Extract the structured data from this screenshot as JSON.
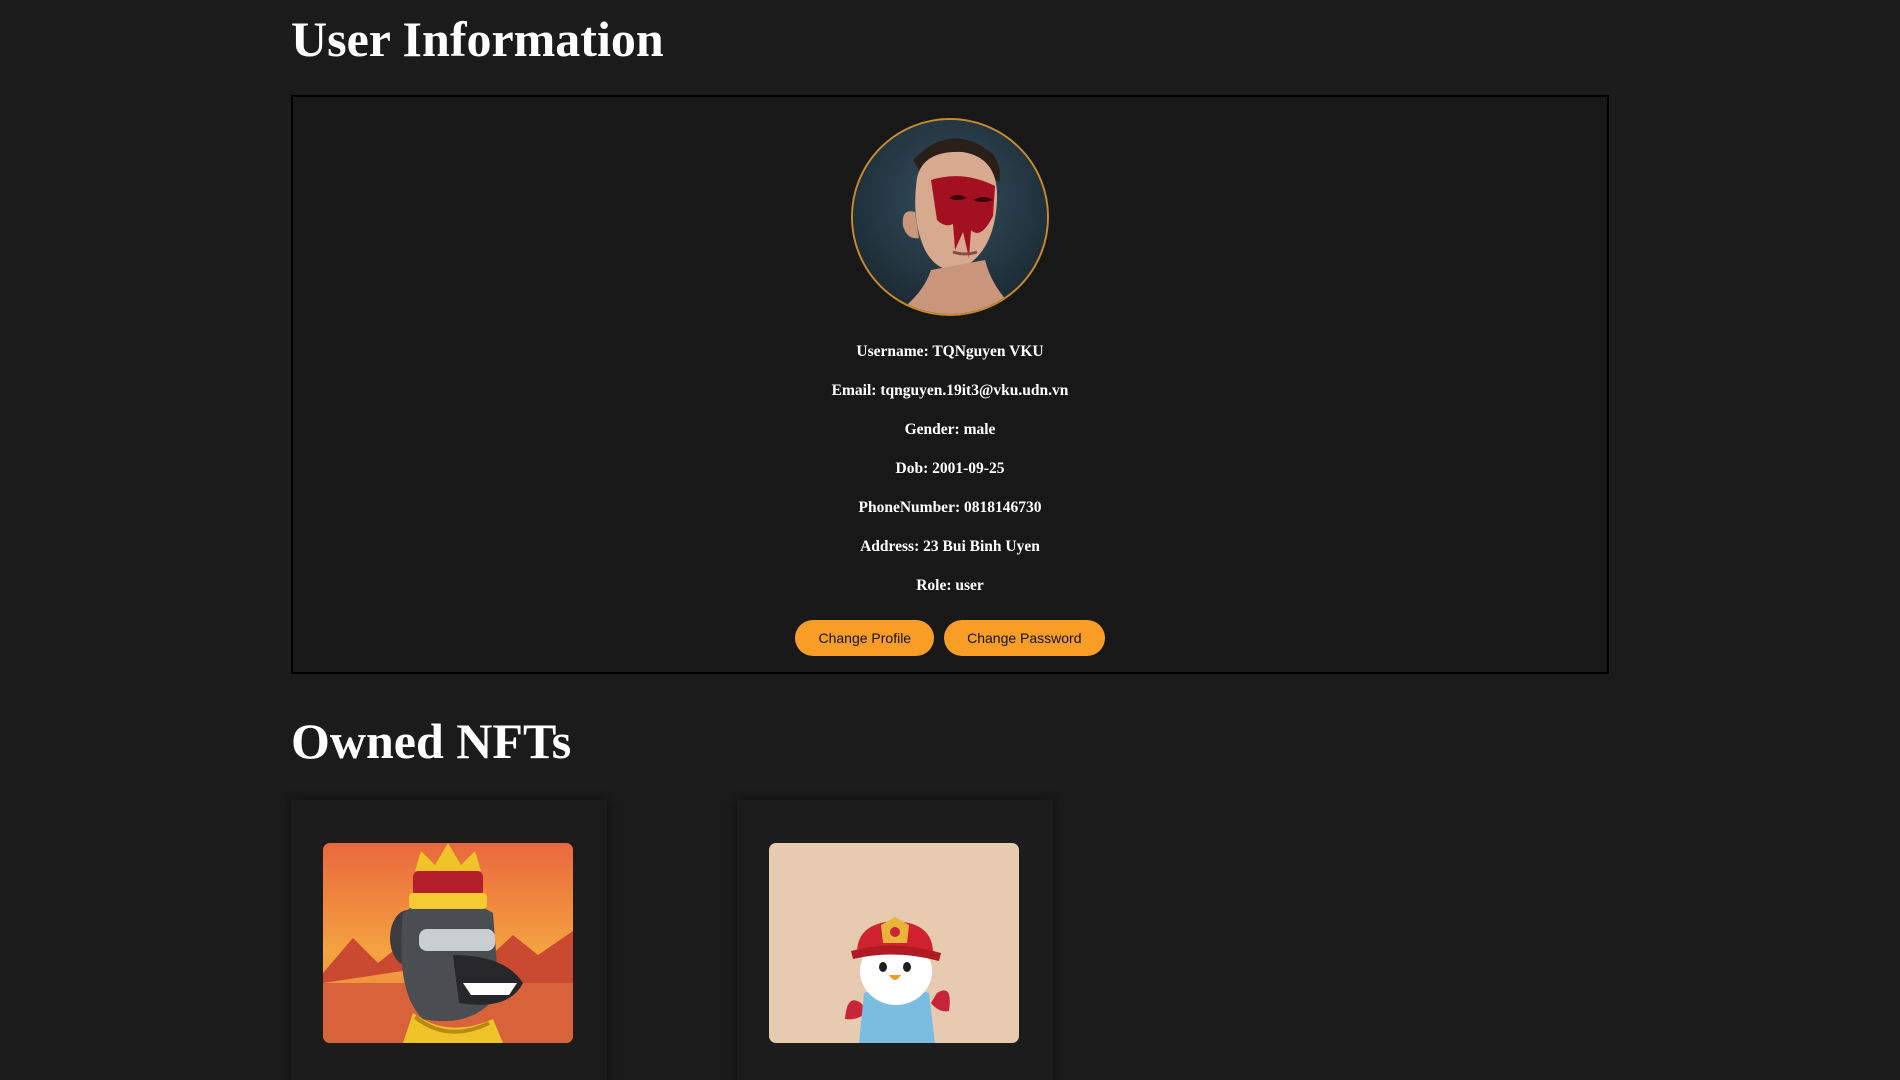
{
  "user_section": {
    "title": "User Information",
    "fields": [
      {
        "label": "Username",
        "value": "TQNguyen VKU"
      },
      {
        "label": "Email",
        "value": "tqnguyen.19it3@vku.udn.vn"
      },
      {
        "label": "Gender",
        "value": "male"
      },
      {
        "label": "Dob",
        "value": "2001-09-25"
      },
      {
        "label": "PhoneNumber",
        "value": "0818146730"
      },
      {
        "label": "Address",
        "value": "23 Bui Binh Uyen"
      },
      {
        "label": "Role",
        "value": "user"
      }
    ],
    "buttons": {
      "change_profile": "Change Profile",
      "change_password": "Change Password"
    }
  },
  "nft_section": {
    "title": "Owned NFTs",
    "items": [
      {
        "image": "nft-king-bulldog-image"
      },
      {
        "image": "nft-firefighter-penguin-image"
      }
    ]
  },
  "colors": {
    "background": "#1b1b1b",
    "card_border": "#000000",
    "button": "#f89d26",
    "avatar_border": "#c98a2a",
    "text": "#ffffff"
  }
}
